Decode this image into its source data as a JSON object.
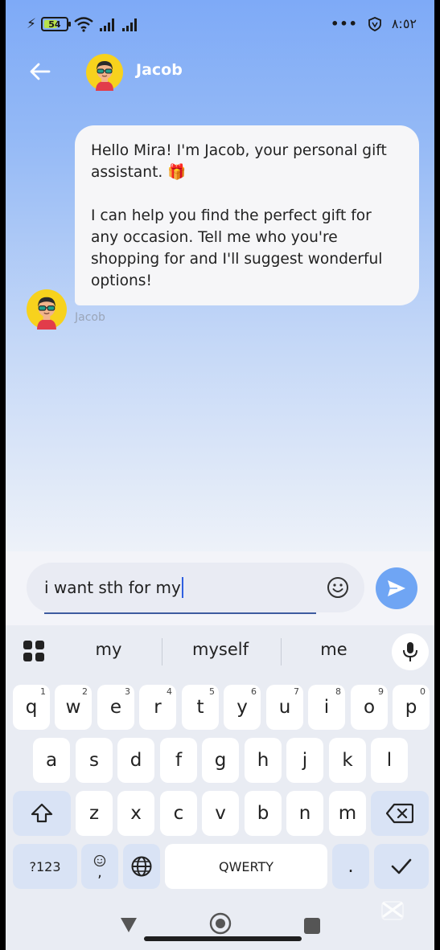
{
  "status_bar": {
    "battery": "54",
    "clock": "٨:٥٢",
    "more_dots": "•••"
  },
  "header": {
    "contact_name": "Jacob"
  },
  "chat": {
    "messages": [
      {
        "sender": "Jacob",
        "text": "Hello Mira! I'm Jacob, your personal gift assistant. 🎁\n\nI can help you find the perfect gift for any occasion. Tell me who you're shopping for and I'll suggest wonderful options!"
      }
    ]
  },
  "composer": {
    "text": "i want sth for my"
  },
  "keyboard": {
    "suggestions": [
      "my",
      "myself",
      "me"
    ],
    "row1": [
      {
        "key": "q",
        "hint": "1"
      },
      {
        "key": "w",
        "hint": "2"
      },
      {
        "key": "e",
        "hint": "3"
      },
      {
        "key": "r",
        "hint": "4"
      },
      {
        "key": "t",
        "hint": "5"
      },
      {
        "key": "y",
        "hint": "6"
      },
      {
        "key": "u",
        "hint": "7"
      },
      {
        "key": "i",
        "hint": "8"
      },
      {
        "key": "o",
        "hint": "9"
      },
      {
        "key": "p",
        "hint": "0"
      }
    ],
    "row2": [
      "a",
      "s",
      "d",
      "f",
      "g",
      "h",
      "j",
      "k",
      "l"
    ],
    "row3": [
      "z",
      "x",
      "c",
      "v",
      "b",
      "n",
      "m"
    ],
    "symbols_key": "?123",
    "emoji_comma_key": ",",
    "space_label": "QWERTY",
    "period_key": "."
  },
  "colors": {
    "header_gradient_top": "#7eaaf7",
    "send_button": "#6fa5f4",
    "keyboard_bg": "#e9ecf3"
  }
}
